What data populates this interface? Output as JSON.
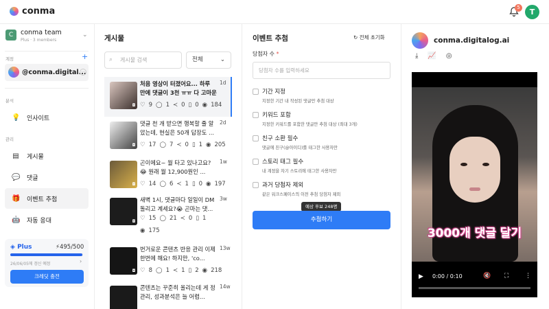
{
  "header": {
    "brand": "conma",
    "notif_count": "5",
    "user_initial": "T"
  },
  "sidebar": {
    "team_name": "conma team",
    "team_sub": "Plus · 3 members",
    "account_label": "계정",
    "account_name": "@conma.digital...",
    "analysis_label": "분석",
    "manage_label": "관리",
    "nav_insight": "인사이트",
    "nav_posts": "게시물",
    "nav_comments": "댓글",
    "nav_event": "이벤트 추첨",
    "nav_auto": "자동 응대",
    "plan_name": "Plus",
    "credit": "⚡495/500",
    "credit_fraction": 0.99,
    "renew": "26/06/05에 갱신 예정",
    "charge_btn": "크레딧 충전"
  },
  "posts": {
    "title": "게시물",
    "search_placeholder": "게시물 검색",
    "filter": "전체",
    "items": [
      {
        "text": "처음 영상이 터졌어요... 하루 만에 댓글이 3천 ㅠㅠ 다 고마운 ...",
        "age": "1d",
        "likes": "9",
        "comments": "1",
        "shares": "0",
        "saves": "0",
        "views": "184"
      },
      {
        "text": "댓글 천 개 받으면 행복할 줄 알았는데, 현실은 50개 답장도 ...",
        "age": "2d",
        "likes": "17",
        "comments": "7",
        "shares": "0",
        "saves": "1",
        "views": "205"
      },
      {
        "text": "곤이에요~ 월 타고 있나고요?😂 원래 월 12,900원인 ...",
        "age": "1w",
        "likes": "14",
        "comments": "6",
        "shares": "1",
        "saves": "0",
        "views": "197"
      },
      {
        "text": "새벽 1시, 댓글마다 일일이 DM 돌리고 계세요?😭 곤마는 댓...",
        "age": "3w",
        "likes": "15",
        "comments": "21",
        "shares": "0",
        "saves": "1",
        "views": "175"
      },
      {
        "text": "번거로운 콘텐츠 반응 관리 이제 한번에 해요! 하지만, 'co...",
        "age": "13w",
        "likes": "8",
        "comments": "1",
        "shares": "1",
        "saves": "2",
        "views": "218"
      },
      {
        "text": "콘텐츠는 꾸준히 올리는데 게 정관리, 성과분석은 늘 어렵...",
        "age": "14w"
      }
    ]
  },
  "event": {
    "title": "이벤트 추첨",
    "reset": "전체 초기화",
    "count_label": "당첨자 수",
    "count_placeholder": "당첨자 수를 입력하세요",
    "options": [
      {
        "title": "기간 지정",
        "desc": "지정한 기간 내 작성된 댓글만 추첨 대상"
      },
      {
        "title": "키워드 포함",
        "desc": "지정한 키워드를 포함한 댓글만 추첨 대상 (최대 3개)"
      },
      {
        "title": "친구 소환 필수",
        "desc": "댓글에 친구(@아이디)를 태그한 사용자만"
      },
      {
        "title": "스토리 태그 필수",
        "desc": "내 계정을 자기 스토리에 태그한 사용자만"
      },
      {
        "title": "과거 당첨자 제외",
        "desc": "같은 워크스페이스의 이전 추첨 당첨자 제외"
      }
    ],
    "tooltip": "예상 후보 248명",
    "draw_btn": "추첨하기"
  },
  "preview": {
    "account": "conma.digitalog.ai",
    "overlay": "3000개 댓글 달기",
    "time": "0:00 / 0:10"
  }
}
